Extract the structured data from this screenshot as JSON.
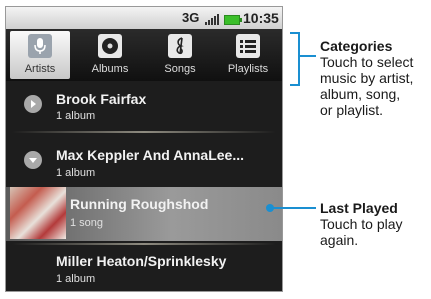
{
  "status_bar": {
    "network": "3G",
    "time": "10:35"
  },
  "tabs": [
    {
      "label": "Artists",
      "icon": "microphone-icon",
      "active": true
    },
    {
      "label": "Albums",
      "icon": "album-icon",
      "active": false
    },
    {
      "label": "Songs",
      "icon": "music-note-icon",
      "active": false
    },
    {
      "label": "Playlists",
      "icon": "list-icon",
      "active": false
    }
  ],
  "list": [
    {
      "title": "Brook Fairfax",
      "subtitle": "1 album",
      "expander": "collapsed"
    },
    {
      "title": "Max Keppler And AnnaLee...",
      "subtitle": "1 album",
      "expander": "expanded"
    },
    {
      "title": "Running Roughshod",
      "subtitle": "1 song",
      "highlighted": true
    },
    {
      "title": "Miller Heaton/Sprinklesky",
      "subtitle": "1 album"
    }
  ],
  "callouts": {
    "categories": {
      "title": "Categories",
      "lines": [
        "Touch to select",
        "music by artist,",
        "album, song,",
        "or playlist."
      ]
    },
    "last_played": {
      "title": "Last Played",
      "lines": [
        "Touch to play",
        "again."
      ]
    }
  },
  "colors": {
    "accent": "#1a8fd1",
    "battery": "#3bbf2a"
  }
}
